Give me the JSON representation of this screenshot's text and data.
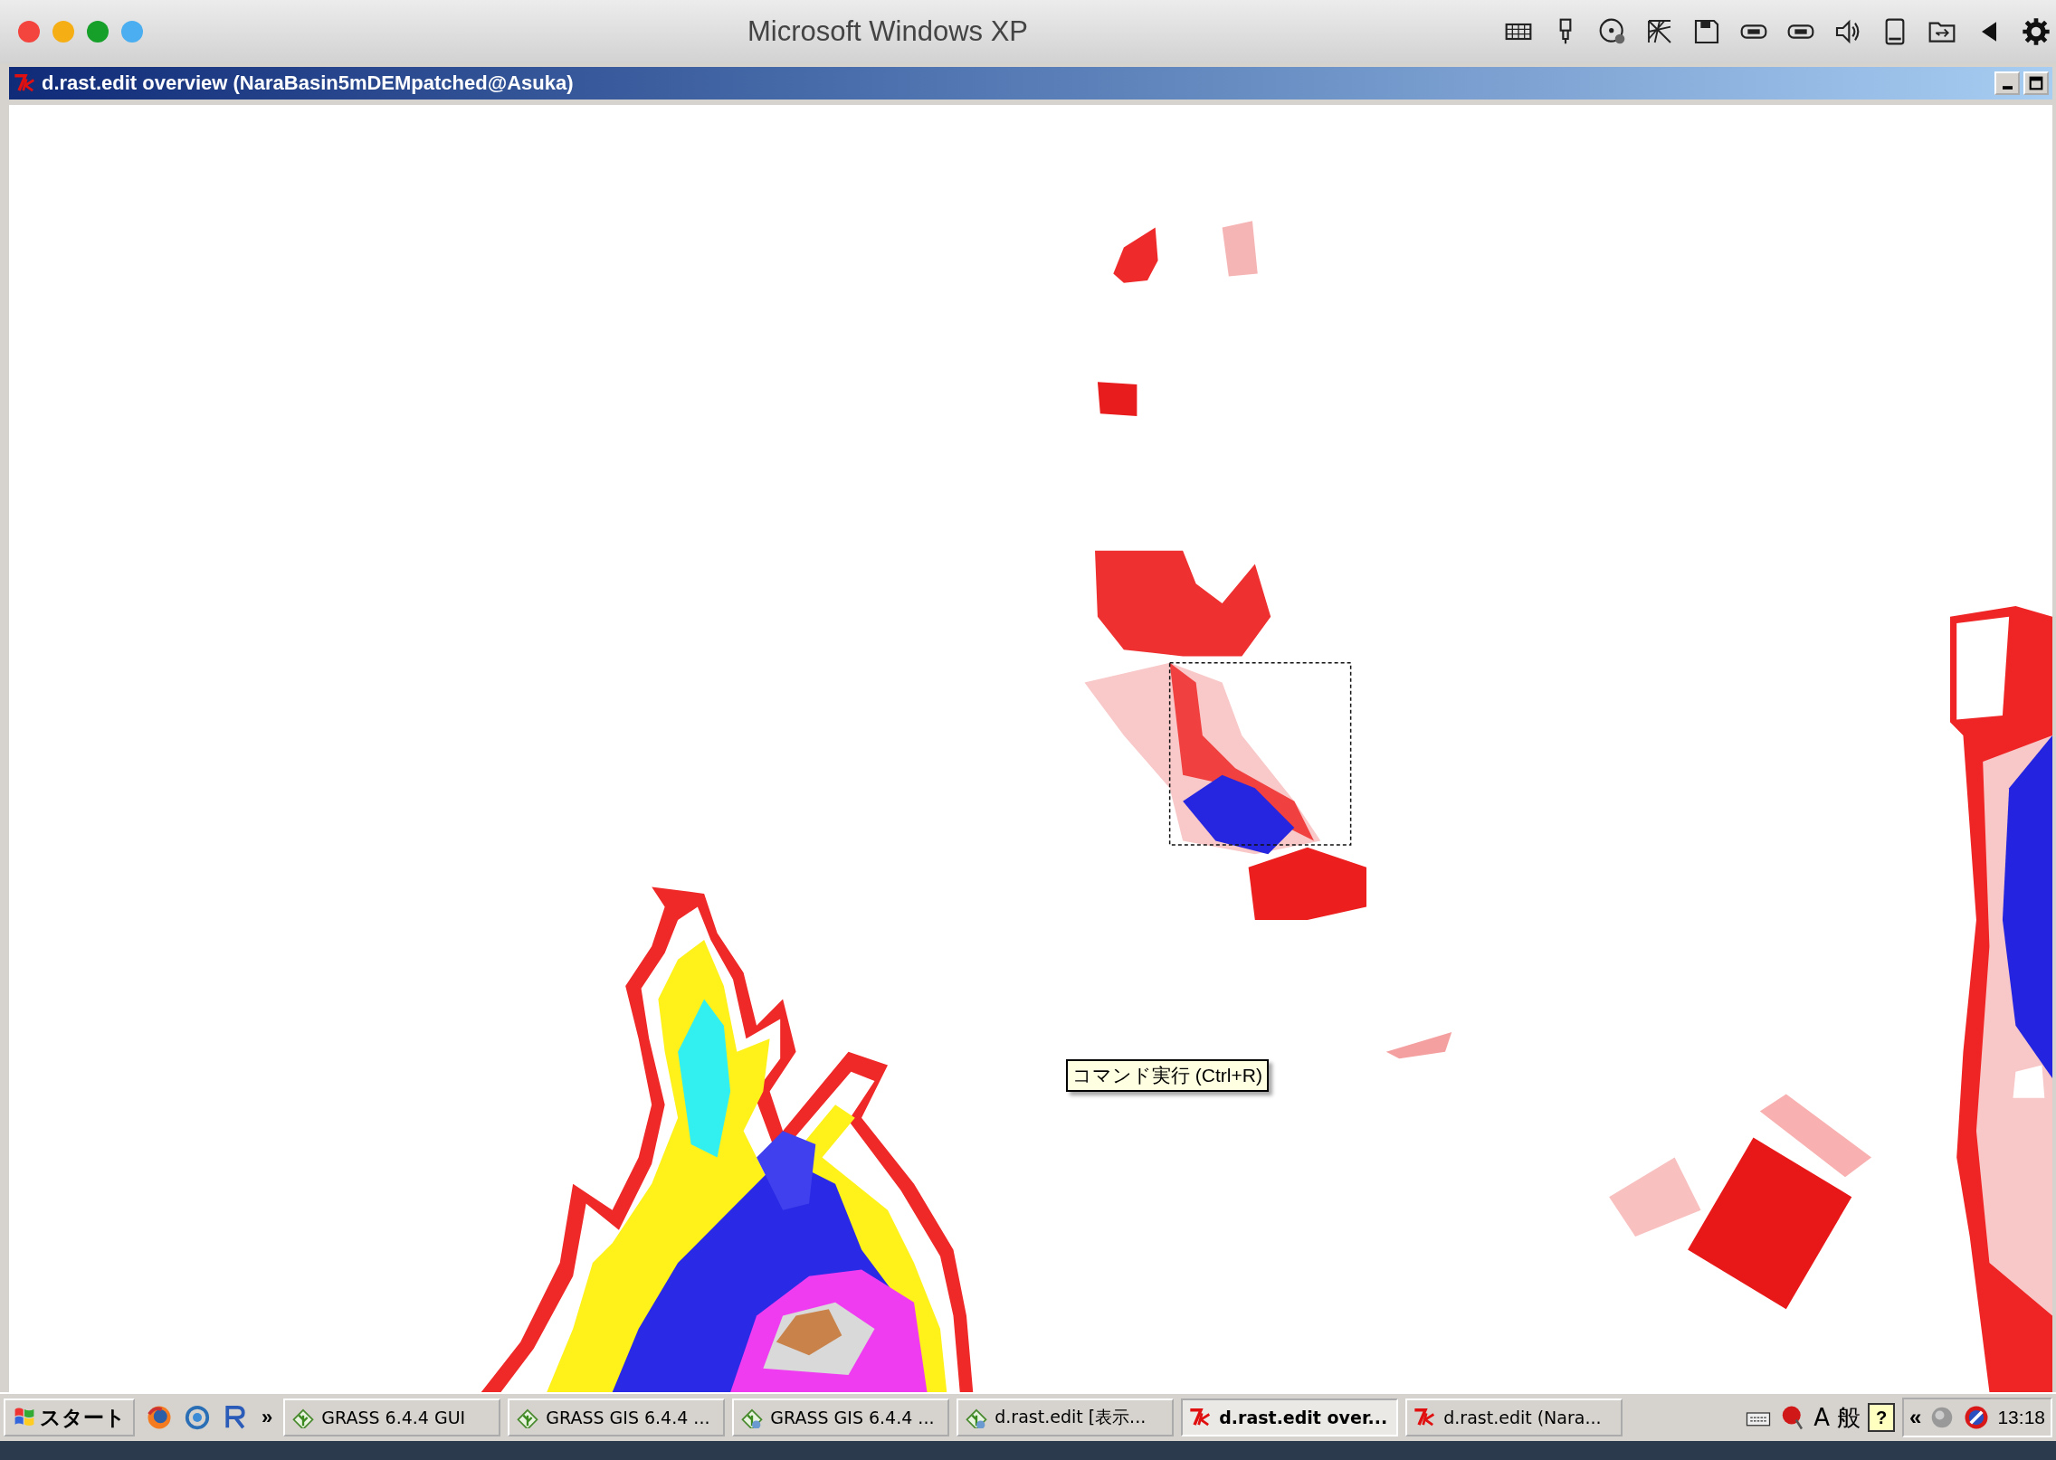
{
  "host_window": {
    "title": "Microsoft Windows XP"
  },
  "window": {
    "title": "d.rast.edit overview (NaraBasin5mDEMpatched@Asuka)"
  },
  "tooltip": "コマンド実行 (Ctrl+R)",
  "taskbar": {
    "start": "スタート",
    "more": "»",
    "tasks": [
      {
        "label": "GRASS 6.4.4 GUI",
        "kind": "grass",
        "selected": false
      },
      {
        "label": "GRASS GIS 6.4.4 ...",
        "kind": "grass",
        "selected": false
      },
      {
        "label": "GRASS GIS 6.4.4 ...",
        "kind": "grass-globe",
        "selected": false
      },
      {
        "label": "d.rast.edit [表示...",
        "kind": "grass-globe",
        "selected": false
      },
      {
        "label": "d.rast.edit over...",
        "kind": "tk",
        "selected": true
      },
      {
        "label": "d.rast.edit (Nara...",
        "kind": "tk",
        "selected": false
      }
    ],
    "ime": [
      "A",
      "般"
    ],
    "help": "?",
    "expand": "«",
    "clock": "13:18"
  }
}
